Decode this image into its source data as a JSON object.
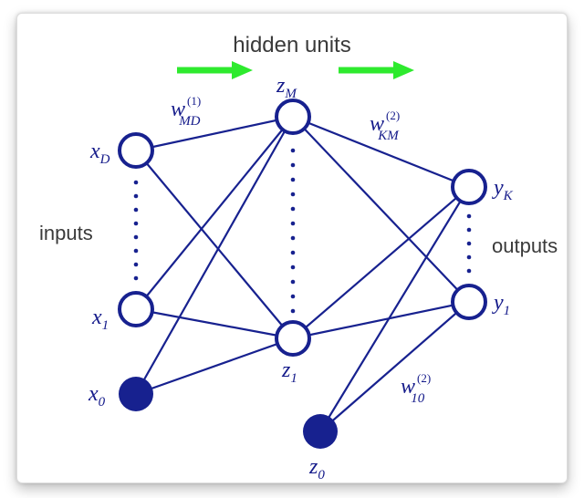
{
  "title": "hidden units",
  "labels": {
    "inputs": "inputs",
    "outputs": "outputs"
  },
  "nodes": {
    "xD": {
      "var": "x",
      "sub": "D"
    },
    "x1": {
      "var": "x",
      "sub": "1"
    },
    "x0": {
      "var": "x",
      "sub": "0"
    },
    "zM": {
      "var": "z",
      "sub": "M"
    },
    "z1": {
      "var": "z",
      "sub": "1"
    },
    "z0": {
      "var": "z",
      "sub": "0"
    },
    "yK": {
      "var": "y",
      "sub": "K"
    },
    "y1": {
      "var": "y",
      "sub": "1"
    }
  },
  "weights": {
    "wMD": {
      "var": "w",
      "sub": "MD",
      "sup": "(1)"
    },
    "wKM": {
      "var": "w",
      "sub": "KM",
      "sup": "(2)"
    },
    "w10": {
      "var": "w",
      "sub": "10",
      "sup": "(2)"
    }
  },
  "colors": {
    "edge": "#17218f",
    "nodeStroke": "#17218f",
    "nodeFillOpen": "#ffffff",
    "nodeFillSolid": "#17218f",
    "arrow": "#2eea2e",
    "dot": "#17218f"
  }
}
